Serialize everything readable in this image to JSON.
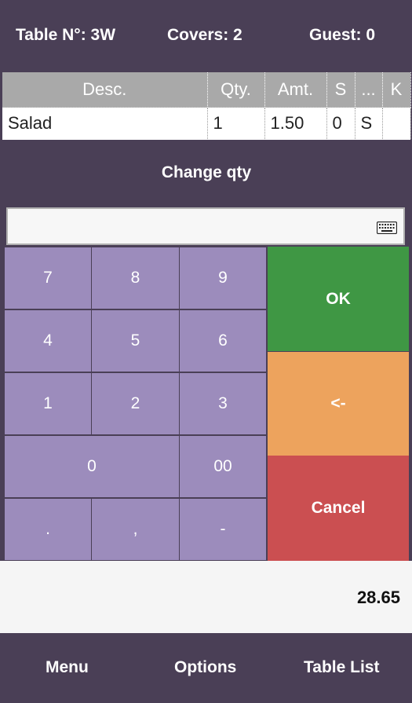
{
  "header": {
    "table": "Table N°: 3W",
    "covers": "Covers: 2",
    "guest": "Guest: 0"
  },
  "order_table": {
    "headers": [
      "Desc.",
      "Qty.",
      "Amt.",
      "S",
      "...",
      "K"
    ],
    "rows": [
      {
        "desc": "Salad",
        "qty": "1",
        "amt": "1.50",
        "s": "0",
        "extra": "S",
        "k": ""
      }
    ]
  },
  "dialog": {
    "title": "Change qty",
    "input_value": "",
    "keys": {
      "k7": "7",
      "k8": "8",
      "k9": "9",
      "k4": "4",
      "k5": "5",
      "k6": "6",
      "k1": "1",
      "k2": "2",
      "k3": "3",
      "k0": "0",
      "k00": "00",
      "kdot": ".",
      "kcomma": ",",
      "kminus": "-"
    },
    "ok": "OK",
    "backspace": "<-",
    "cancel": "Cancel"
  },
  "total": "28.65",
  "footer": {
    "menu": "Menu",
    "options": "Options",
    "table_list": "Table List"
  },
  "colors": {
    "background": "#4a3f56",
    "key": "#9c8cbc",
    "ok": "#3f9744",
    "backspace": "#eda35d",
    "cancel": "#cb4f51"
  }
}
